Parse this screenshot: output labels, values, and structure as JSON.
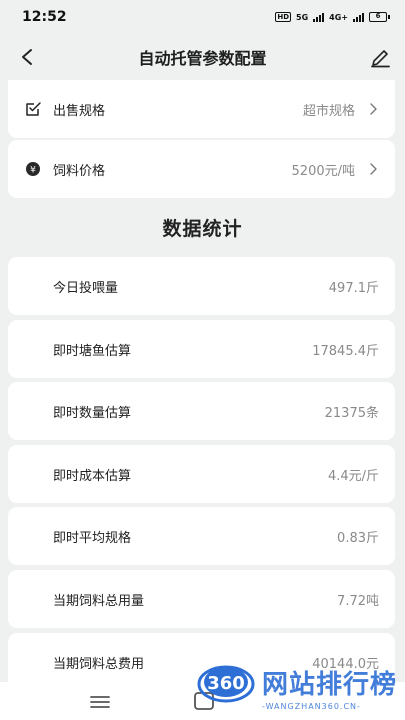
{
  "status_bar": {
    "time": "12:52",
    "network_1": "5G",
    "network_2": "4G+",
    "battery": "6"
  },
  "header": {
    "title": "自动托管参数配置",
    "back_icon": "chevron-left-icon",
    "edit_icon": "pencil-icon"
  },
  "settings": [
    {
      "label": "出售规格",
      "value": "超市规格",
      "icon": "checkbox-edit-icon"
    },
    {
      "label": "饲料价格",
      "value": "5200元/吨",
      "icon": "yen-coin-icon"
    }
  ],
  "stats": {
    "title": "数据统计",
    "rows": [
      {
        "label": "今日投喂量",
        "value": "497.1斤"
      },
      {
        "label": "即时塘鱼估算",
        "value": "17845.4斤"
      },
      {
        "label": "即时数量估算",
        "value": "21375条"
      },
      {
        "label": "即时成本估算",
        "value": "4.4元/斤"
      },
      {
        "label": "即时平均规格",
        "value": "0.83斤"
      },
      {
        "label": "当期饲料总用量",
        "value": "7.72吨"
      },
      {
        "label": "当期饲料总费用",
        "value": "40144.0元"
      }
    ]
  },
  "watermark": {
    "logo_text": "360",
    "title": "网站排行榜",
    "subtitle": "-WANGZHAN360.CN-"
  },
  "colors": {
    "background": "#eef1f0",
    "card": "#ffffff",
    "value_text": "#8a8a8a",
    "watermark": "#2e6fd6"
  }
}
